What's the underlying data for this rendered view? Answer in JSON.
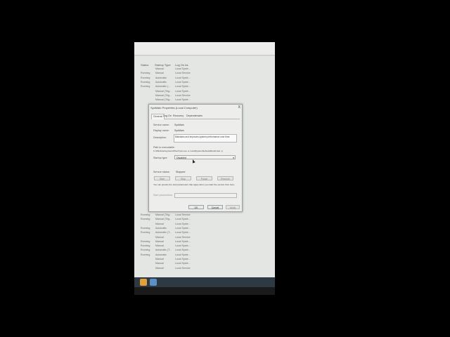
{
  "services": {
    "columns": {
      "status": "Status",
      "startup_type": "Startup Type",
      "log_on_as": "Log On As"
    },
    "rows_top": [
      {
        "status": "",
        "startup": "Manual",
        "logon": "Local Syste..."
      },
      {
        "status": "Running",
        "startup": "Manual",
        "logon": "Local Service"
      },
      {
        "status": "Running",
        "startup": "Automatic",
        "logon": "Local Syste..."
      },
      {
        "status": "Running",
        "startup": "Automatic",
        "logon": "Local Syste..."
      },
      {
        "status": "Running",
        "startup": "Automatic (...",
        "logon": "Local Syste..."
      },
      {
        "status": "",
        "startup": "Manual (Trig...",
        "logon": "Local Syste..."
      },
      {
        "status": "",
        "startup": "Manual (Trig...",
        "logon": "Local Service"
      },
      {
        "status": "",
        "startup": "Manual (Trig...",
        "logon": "Local Syste..."
      }
    ],
    "rows_bottom": [
      {
        "status": "Running",
        "startup": "Manual (Trig...",
        "logon": "Local Service"
      },
      {
        "status": "Running",
        "startup": "Manual (Trig...",
        "logon": "Local Syste..."
      },
      {
        "status": "",
        "startup": "Manual",
        "logon": "Local Syste..."
      },
      {
        "status": "Running",
        "startup": "Automatic",
        "logon": "Local Syste..."
      },
      {
        "status": "Running",
        "startup": "Automatic (T...",
        "logon": "Local Syste..."
      },
      {
        "status": "",
        "startup": "Manual",
        "logon": "Local Service"
      },
      {
        "status": "Running",
        "startup": "Manual",
        "logon": "Local Syste..."
      },
      {
        "status": "Running",
        "startup": "Manual",
        "logon": "Local Syste..."
      },
      {
        "status": "Running",
        "startup": "Automatic (T...",
        "logon": "Local Syste..."
      },
      {
        "status": "Running",
        "startup": "Automatic",
        "logon": "Local Syste..."
      },
      {
        "status": "",
        "startup": "Manual",
        "logon": "Local Syste..."
      },
      {
        "status": "",
        "startup": "Manual",
        "logon": "Local Syste..."
      },
      {
        "status": "",
        "startup": "Manual",
        "logon": "Local Service"
      }
    ]
  },
  "dialog": {
    "title": "SysMain Properties (Local Computer)",
    "close": "X",
    "tabs": [
      "General",
      "Log On",
      "Recovery",
      "Dependencies"
    ],
    "service_name_label": "Service name:",
    "service_name": "SysMain",
    "display_name_label": "Display name:",
    "display_name": "SysMain",
    "description_label": "Description:",
    "description": "Maintains and improves system performance over time.",
    "path_label": "Path to executable:",
    "path": "C:\\Windows\\system32\\svchost.exe -k LocalSystemNetworkRestricted -p",
    "startup_type_label": "Startup type:",
    "startup_type": "Disabled",
    "service_status_label": "Service status:",
    "service_status": "Stopped",
    "buttons": {
      "start": "Start",
      "stop": "Stop",
      "pause": "Pause",
      "resume": "Resume"
    },
    "hint": "You can specify the start parameters that apply when you start the service from here.",
    "start_params_label": "Start parameters:",
    "ok": "OK",
    "cancel": "Cancel",
    "apply": "Apply"
  }
}
